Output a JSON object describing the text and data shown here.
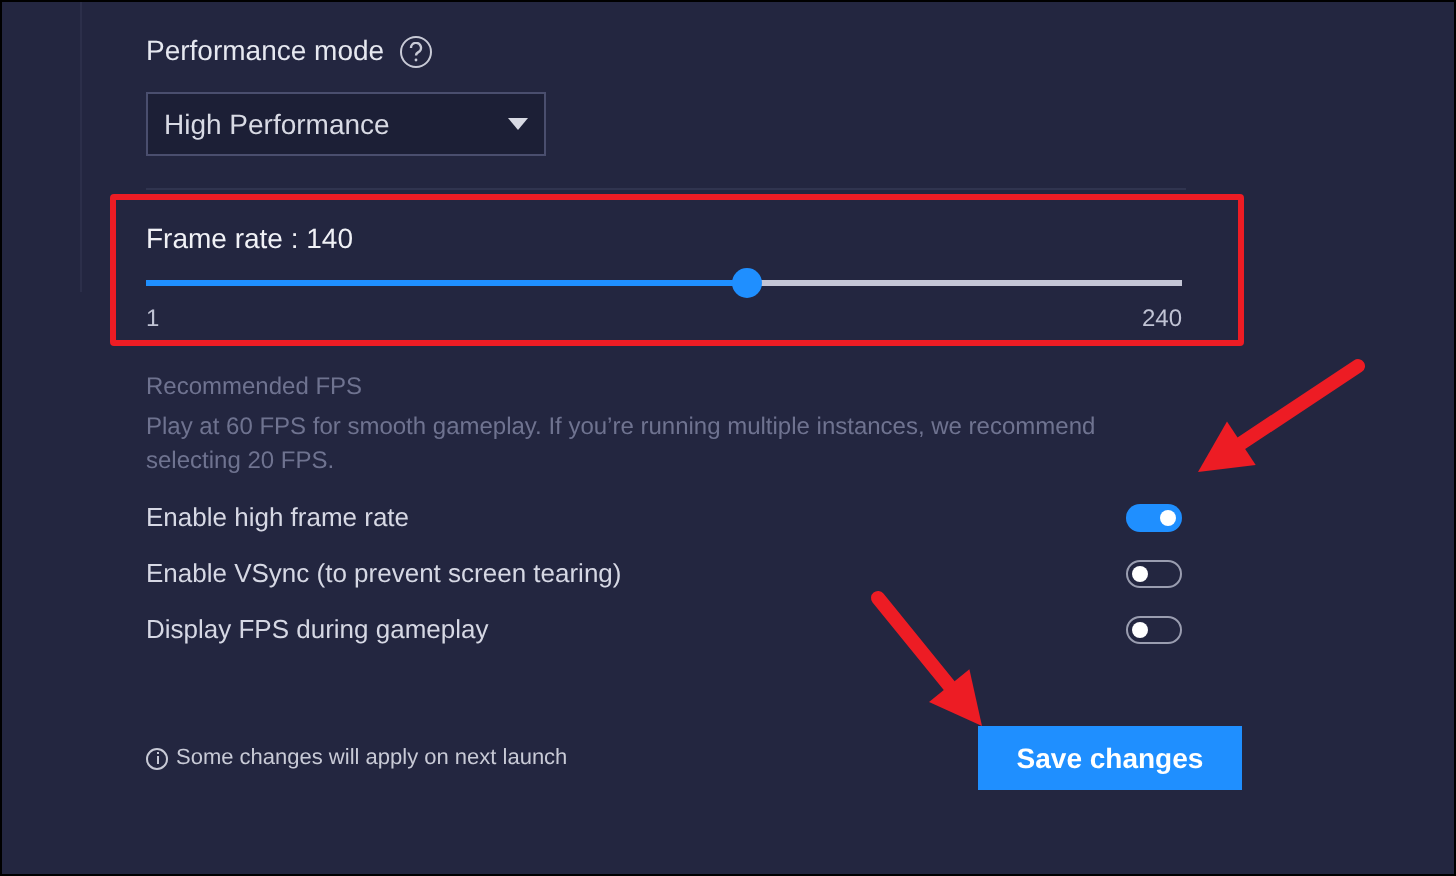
{
  "performance_mode": {
    "label": "Performance mode",
    "value": "High Performance"
  },
  "frame_rate": {
    "label": "Frame rate : 140",
    "level": 0.58,
    "min": "1",
    "max": "240"
  },
  "recommended": {
    "title": "Recommended FPS",
    "text": "Play at 60 FPS for smooth gameplay. If you’re running multiple instances, we recommend selecting 20 FPS."
  },
  "toggles": [
    {
      "label": "Enable high frame rate",
      "on": true
    },
    {
      "label": "Enable VSync (to prevent screen tearing)",
      "on": false
    },
    {
      "label": "Display FPS during gameplay",
      "on": false
    }
  ],
  "note": "Some changes will apply on next launch",
  "save_button": "Save changes"
}
